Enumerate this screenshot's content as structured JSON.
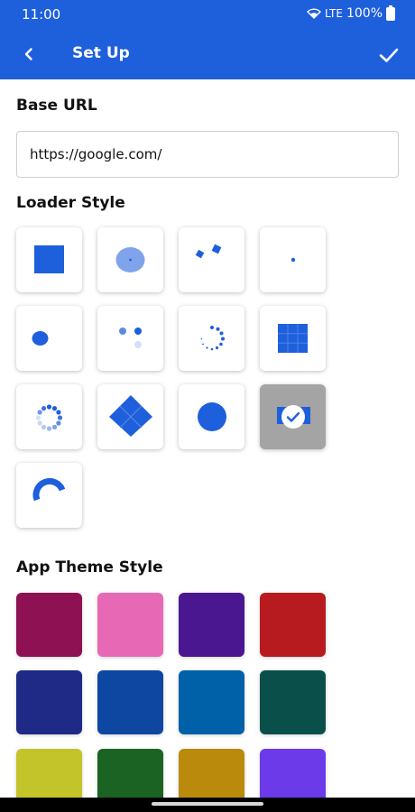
{
  "status_bar": {
    "time": "11:00",
    "network": "LTE",
    "battery": "100%"
  },
  "app_bar": {
    "title": "Set Up",
    "back_icon": "back-chevron-icon",
    "confirm_icon": "checkmark-icon"
  },
  "base_url": {
    "label": "Base URL",
    "value": "https://google.com/"
  },
  "loader_style": {
    "label": "Loader Style",
    "accent_color": "#1e5fdc",
    "selected_index": 11,
    "options": [
      "square",
      "pulse-ellipse",
      "rotating-squares",
      "dot",
      "bouncing-ellipse",
      "three-dots",
      "spinner-dots",
      "grid",
      "fading-circle",
      "folding-cube",
      "filled-circle",
      "wandering-cubes",
      "arc"
    ]
  },
  "app_theme_style": {
    "label": "App Theme Style",
    "colors": [
      "#8e1253",
      "#e768b4",
      "#4a1791",
      "#b81b1f",
      "#1e2a86",
      "#0d47a1",
      "#0060a8",
      "#0b4f4a",
      "#c2c42a",
      "#1b6322",
      "#ba8a0c",
      "#6c3ae8"
    ]
  }
}
